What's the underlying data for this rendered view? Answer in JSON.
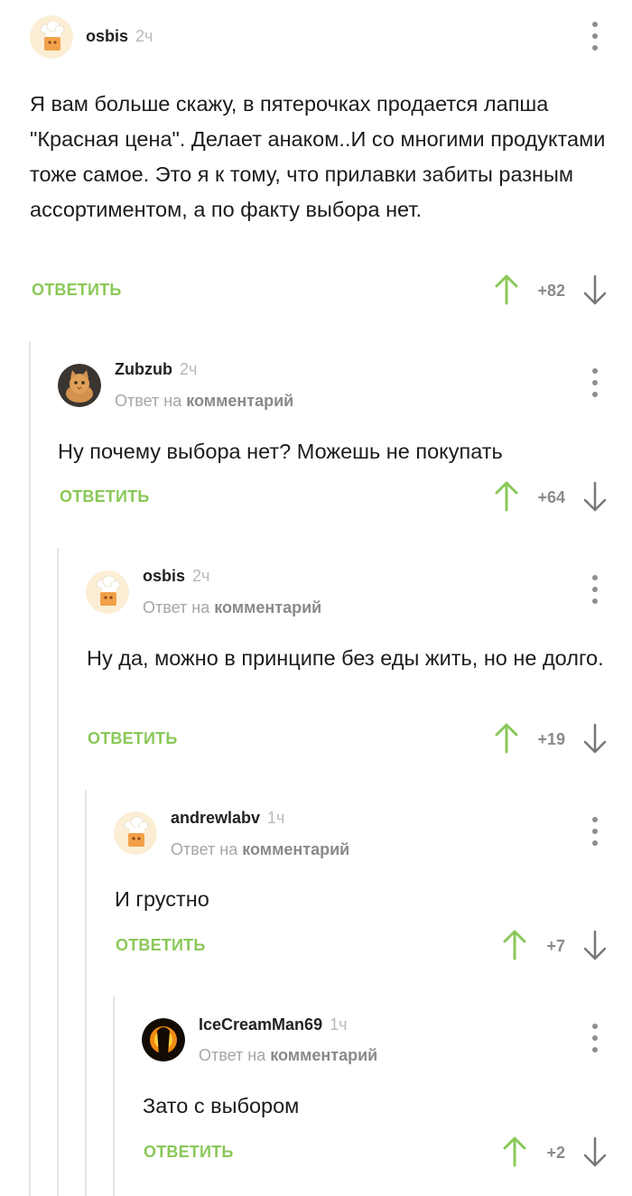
{
  "reply_label": "ОТВЕТИТЬ",
  "reply_to_prefix": "Ответ на",
  "reply_to_target": "комментарий",
  "colors": {
    "accent_green": "#8ac858",
    "thread_line": "#e6e6e6",
    "muted": "#a6a6a6"
  },
  "icons": {
    "upvote": "arrow-up-icon",
    "downvote": "arrow-down-icon",
    "menu": "more-vertical-icon"
  },
  "comments": [
    {
      "author": "osbis",
      "time": "2ч",
      "body": "Я вам больше скажу, в пятерочках продается лапша \"Красная цена\". Делает анаком..И со многими продуктами тоже самое. Это я к тому, что прилавки забиты разным ассортиментом, а по факту выбора нет.",
      "score": "+82"
    },
    {
      "author": "Zubzub",
      "time": "2ч",
      "body": "Ну почему выбора нет? Можешь не покупать",
      "score": "+64"
    },
    {
      "author": "osbis",
      "time": "2ч",
      "body": "Ну да, можно в принципе без еды жить, но не долго.",
      "score": "+19"
    },
    {
      "author": "andrewlabv",
      "time": "1ч",
      "body": "И грустно",
      "score": "+7"
    },
    {
      "author": "IceCreamMan69",
      "time": "1ч",
      "body": "Зато с выбором",
      "score": "+2"
    }
  ]
}
